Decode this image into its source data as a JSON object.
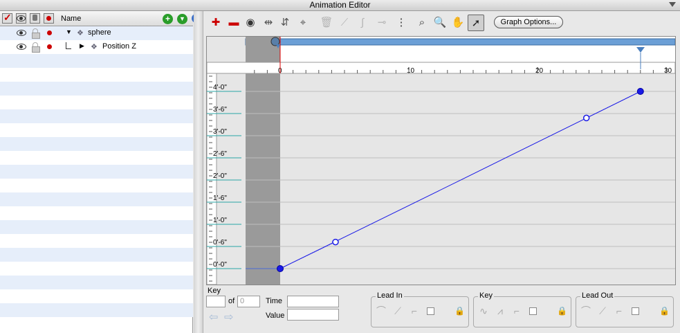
{
  "window": {
    "title": "Animation Editor"
  },
  "outline": {
    "name_header": "Name",
    "rows": [
      {
        "label": "sphere",
        "expand": "▼"
      },
      {
        "label": "Position Z",
        "expand": "▶"
      }
    ]
  },
  "toolbar": {
    "graph_options_label": "Graph Options..."
  },
  "timeline": {
    "ticks": [
      "0",
      "10",
      "20",
      "30"
    ]
  },
  "chart_data": {
    "type": "line",
    "title": "",
    "xlabel": "",
    "ylabel": "",
    "xlim": [
      -2.7,
      30.8
    ],
    "ylim": [
      -0.5,
      4.5
    ],
    "y_tick_labels": [
      "0'-0\"",
      "0'-6\"",
      "1'-0\"",
      "1'-6\"",
      "2'-0\"",
      "2'-6\"",
      "3'-0\"",
      "3'-6\"",
      "4'-0\""
    ],
    "y_tick_values": [
      0,
      0.5,
      1,
      1.5,
      2,
      2.5,
      3,
      3.5,
      4
    ],
    "x_tick_labels": [
      "0",
      "10",
      "20",
      "30"
    ],
    "keys": [
      {
        "x": 0,
        "y": 0
      },
      {
        "x": 28,
        "y": 4
      }
    ],
    "handles": [
      {
        "x": 4.3,
        "y": 0.6
      },
      {
        "x": 23.8,
        "y": 3.4
      }
    ],
    "line_color": "#1a1ae6",
    "grid": true
  },
  "footer": {
    "key_label": "Key",
    "of_label": "of",
    "of_value": "0",
    "time_label": "Time",
    "value_label": "Value",
    "lead_in_label": "Lead In",
    "key_group_label": "Key",
    "lead_out_label": "Lead Out"
  }
}
